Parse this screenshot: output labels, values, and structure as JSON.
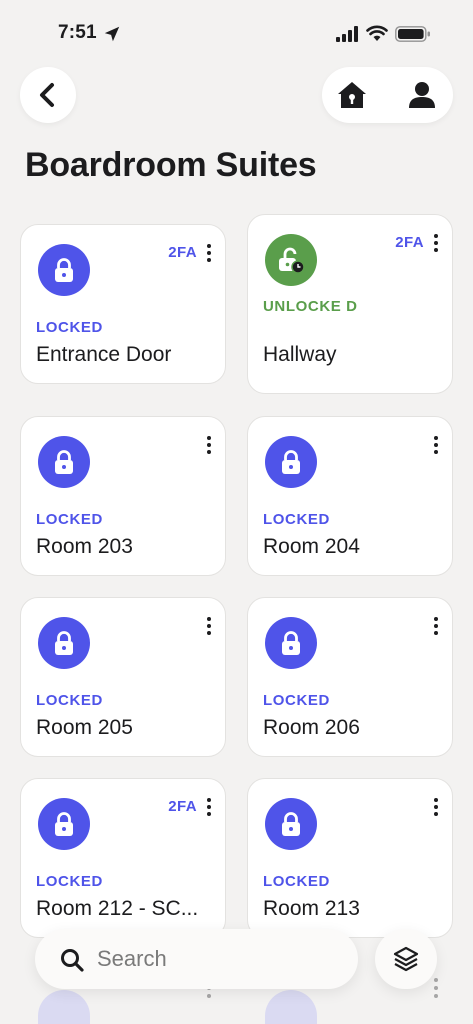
{
  "status_bar": {
    "time": "7:51"
  },
  "header": {
    "title": "Boardroom Suites"
  },
  "cards": [
    {
      "status": "LOCKED",
      "name": "Entrance Door",
      "badge": "2FA"
    },
    {
      "status": "UNLOCKE D",
      "name": "Hallway",
      "badge": "2FA"
    },
    {
      "status": "LOCKED",
      "name": "Room 203"
    },
    {
      "status": "LOCKED",
      "name": "Room 204"
    },
    {
      "status": "LOCKED",
      "name": "Room 205"
    },
    {
      "status": "LOCKED",
      "name": "Room 206"
    },
    {
      "status": "LOCKED",
      "name": "Room 212 - SC...",
      "badge": "2FA"
    },
    {
      "status": "LOCKED",
      "name": "Room 213"
    }
  ],
  "search": {
    "placeholder": "Search"
  },
  "colors": {
    "locked": "#4f54e9",
    "unlocked": "#5a9e4b",
    "background": "#f3f2f1"
  }
}
